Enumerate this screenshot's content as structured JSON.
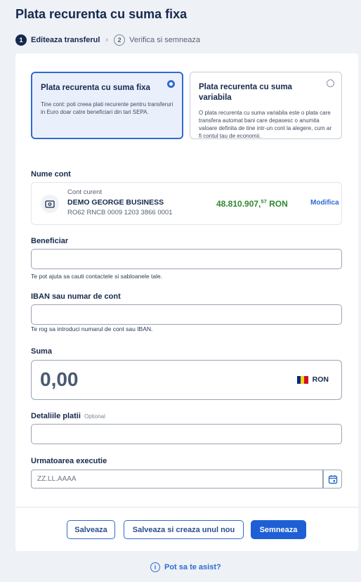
{
  "page": {
    "title": "Plata recurenta cu suma fixa"
  },
  "stepper": {
    "steps": [
      {
        "number": "1",
        "label": "Editeaza transferul",
        "active": true
      },
      {
        "number": "2",
        "label": "Verifica si semneaza",
        "active": false
      }
    ],
    "separator": "›"
  },
  "payment_types": [
    {
      "title": "Plata recurenta cu suma fixa",
      "description": "Tine cont: poti creea plati recurente pentru transferuri in Euro doar catre beneficiari din tari SEPA.",
      "selected": true
    },
    {
      "title": "Plata recurenta cu suma variabila",
      "description": "O plata recurenta cu suma variabila este o plata care transfera automat bani care depasesc o anumita valoare definita de tine intr-un cont la alegere, cum ar fi contul tau de economii.",
      "selected": false
    }
  ],
  "account": {
    "label": "Nume cont",
    "type": "Cont curent",
    "name": "DEMO GEORGE BUSINESS",
    "iban": "RO62 RNCB 0009 1203 3866 0001",
    "balance_main": "48.810.907,",
    "balance_decimals": "57",
    "currency": "RON",
    "modify_label": "Modifica",
    "icon": "wallet-icon"
  },
  "beneficiary": {
    "label": "Beneficiar",
    "value": "",
    "helper": "Te pot ajuta sa cauti contactele si sabloanele tale."
  },
  "iban_field": {
    "label": "IBAN sau numar de cont",
    "value": "",
    "helper": "Te rog sa introduci numarul de cont sau IBAN."
  },
  "amount": {
    "label": "Suma",
    "value": "0,00",
    "currency": "RON",
    "flag_colors": [
      "#002b7f",
      "#fcd116",
      "#ce1126"
    ]
  },
  "details": {
    "label": "Detaliile platii",
    "optional": "Optional",
    "value": ""
  },
  "next_execution": {
    "label": "Urmatoarea executie",
    "placeholder": "ZZ.LL.AAAA",
    "icon": "calendar-icon"
  },
  "buttons": {
    "save": "Salveaza",
    "save_template": "Salveaza si creaza unul nou",
    "sign": "Semneaza"
  },
  "help": {
    "label": "Pot sa te asist?",
    "icon": "info-icon"
  },
  "colors": {
    "accent": "#2f6bd1",
    "balance": "#2e8a2f",
    "title": "#16294d"
  }
}
